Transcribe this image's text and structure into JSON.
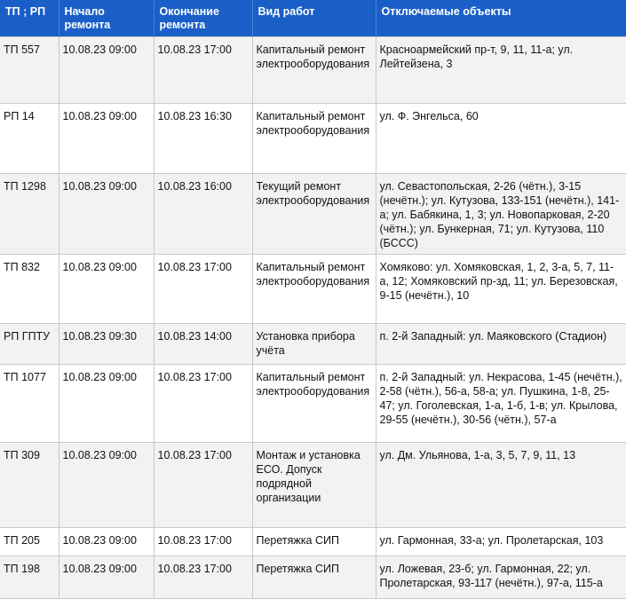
{
  "headers": {
    "tp": "ТП ; РП",
    "start": "Начало ремонта",
    "end": "Окончание ремонта",
    "work": "Вид работ",
    "objects": "Отключаемые объекты"
  },
  "rows": [
    {
      "tp": "ТП 557",
      "start": "10.08.23 09:00",
      "end": "10.08.23 17:00",
      "work": "Капитальный ремонт электрооборудования",
      "objects": "Красноармейский пр-т, 9, 11, 11-а; ул. Лейтейзена, 3"
    },
    {
      "tp": "РП 14",
      "start": "10.08.23 09:00",
      "end": "10.08.23 16:30",
      "work": "Капитальный ремонт электрооборудования",
      "objects": "ул. Ф. Энгельса, 60"
    },
    {
      "tp": "ТП 1298",
      "start": "10.08.23 09:00",
      "end": "10.08.23 16:00",
      "work": "Текущий ремонт электрооборудования",
      "objects": "ул. Севастопольская, 2-26 (чётн.), 3-15 (нечётн.); ул. Кутузова, 133-151 (нечётн.), 141-а; ул. Бабякина, 1, 3; ул. Новопарковая, 2-20 (чётн.); ул. Бункерная, 71; ул. Кутузова, 110 (БССС)"
    },
    {
      "tp": "ТП 832",
      "start": "10.08.23 09:00",
      "end": "10.08.23 17:00",
      "work": "Капитальный ремонт электрооборудования",
      "objects": "Хомяково: ул. Хомяковская, 1, 2, 3-а, 5, 7, 11-а, 12; Хомяковский пр-зд, 11; ул. Березовская, 9-15 (нечётн.), 10"
    },
    {
      "tp": "РП ГПТУ",
      "start": "10.08.23 09:30",
      "end": "10.08.23 14:00",
      "work": "Установка прибора учёта",
      "objects": "п. 2-й Западный: ул. Маяковского (Стадион)"
    },
    {
      "tp": "ТП 1077",
      "start": "10.08.23 09:00",
      "end": "10.08.23 17:00",
      "work": "Капитальный ремонт электрооборудования",
      "objects": "п. 2-й Западный: ул. Некрасова, 1-45 (нечётн.), 2-58 (чётн.), 56-а, 58-а; ул. Пушкина, 1-8, 25-47; ул. Гоголевская, 1-а, 1-б, 1-в; ул. Крылова, 29-55 (нечётн.), 30-56 (чётн.), 57-а"
    },
    {
      "tp": "ТП 309",
      "start": "10.08.23 09:00",
      "end": "10.08.23 17:00",
      "work": "Монтаж и установка ЕСО. Допуск подрядной организации",
      "objects": "ул. Дм. Ульянова, 1-а, 3, 5, 7, 9, 11, 13"
    },
    {
      "tp": "ТП 205",
      "start": "10.08.23 09:00",
      "end": "10.08.23 17:00",
      "work": "Перетяжка СИП",
      "objects": "ул. Гармонная, 33-а; ул. Пролетарская, 103"
    },
    {
      "tp": "ТП 198",
      "start": "10.08.23 09:00",
      "end": "10.08.23 17:00",
      "work": "Перетяжка СИП",
      "objects": "ул. Ложевая, 23-б; ул. Гармонная, 22; ул. Пролетарская, 93-117 (нечётн.), 97-а, 115-а"
    }
  ]
}
